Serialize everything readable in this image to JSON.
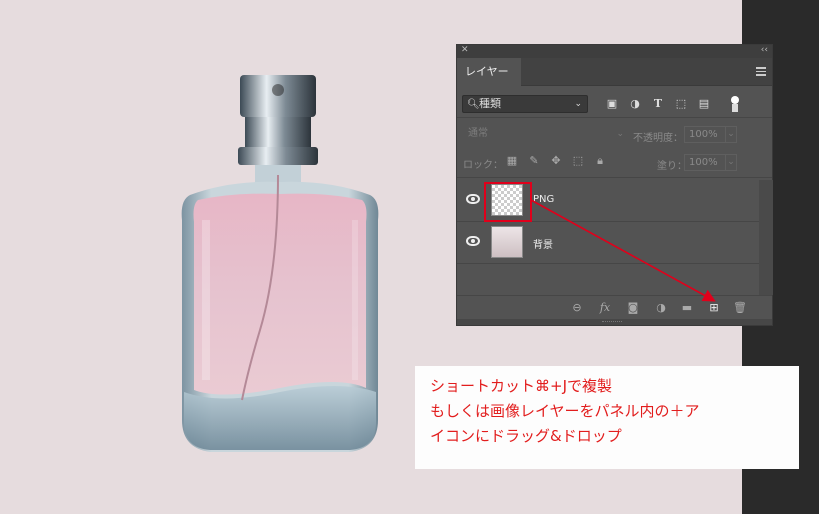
{
  "panel": {
    "close_glyph": "✕",
    "collapse_glyph": "‹‹",
    "tab_label": "レイヤー",
    "filter": {
      "kind_label": "種類",
      "icons": [
        "image-filter-icon",
        "adjustment-filter-icon",
        "type-filter-icon",
        "shape-filter-icon",
        "smartobject-filter-icon",
        "filter-toggle"
      ]
    },
    "blend_mode": "通常",
    "opacity_label": "不透明度：",
    "opacity_value": "100%",
    "lock_label": "ロック：",
    "fill_label": "塗り：",
    "fill_value": "100%",
    "layers": [
      {
        "name": "PNG",
        "visible": true,
        "thumbnail": "transparent"
      },
      {
        "name": "背景",
        "visible": true,
        "thumbnail": "gradient"
      }
    ],
    "footer_icons": [
      "link-icon",
      "fx-icon",
      "mask-icon",
      "adjustment-icon",
      "folder-icon",
      "new-layer-icon",
      "trash-icon"
    ]
  },
  "note": {
    "line1": "ショートカット⌘+Jで複製",
    "line2": "もしくは画像レイヤーをパネル内の＋ア",
    "line3": "イコンにドラッグ&ドロップ"
  },
  "colors": {
    "annotation_red": "#e0001b",
    "panel_bg": "#535353",
    "canvas_bg": "#e6dcde"
  }
}
